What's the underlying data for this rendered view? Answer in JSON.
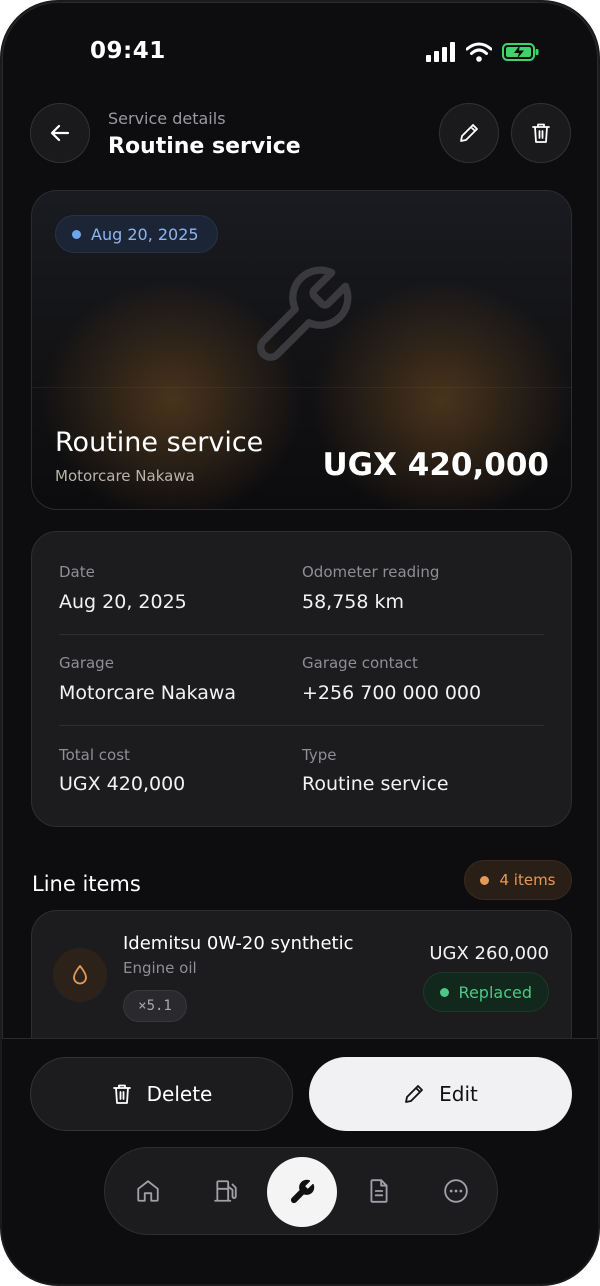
{
  "status_bar": {
    "time": "09:41"
  },
  "header": {
    "subtitle": "Service details",
    "title": "Routine service"
  },
  "hero": {
    "date": "Aug 20, 2025",
    "title": "Routine service",
    "garage": "Motorcare Nakawa",
    "amount": "UGX 420,000"
  },
  "details": {
    "fields": [
      {
        "label": "Date",
        "value": "Aug 20, 2025"
      },
      {
        "label": "Odometer reading",
        "value": "58,758 km"
      },
      {
        "label": "Garage",
        "value": "Motorcare Nakawa"
      },
      {
        "label": "Garage contact",
        "value": "+256 700 000 000"
      },
      {
        "label": "Total cost",
        "value": "UGX 420,000"
      },
      {
        "label": "Type",
        "value": "Routine service"
      }
    ]
  },
  "line_items": {
    "heading": "Line items",
    "count": "4 items",
    "items": [
      {
        "name": "Idemitsu 0W-20 synthetic",
        "category": "Engine oil",
        "quantity": "×5.1",
        "price": "UGX 260,000",
        "status": "Replaced",
        "icon": "oil-drop-icon"
      }
    ]
  },
  "actions": {
    "delete_label": "Delete",
    "edit_label": "Edit"
  },
  "nav": {
    "items": [
      "home-icon",
      "fuel-pump-icon",
      "wrench-icon",
      "document-icon",
      "more-icon"
    ],
    "active": "wrench-icon"
  },
  "colors": {
    "background": "#0d0d0f",
    "card": "#1c1c1f",
    "date_accent": "#8cb6f0",
    "count_accent": "#e39a58",
    "status_green": "#4cc987"
  }
}
